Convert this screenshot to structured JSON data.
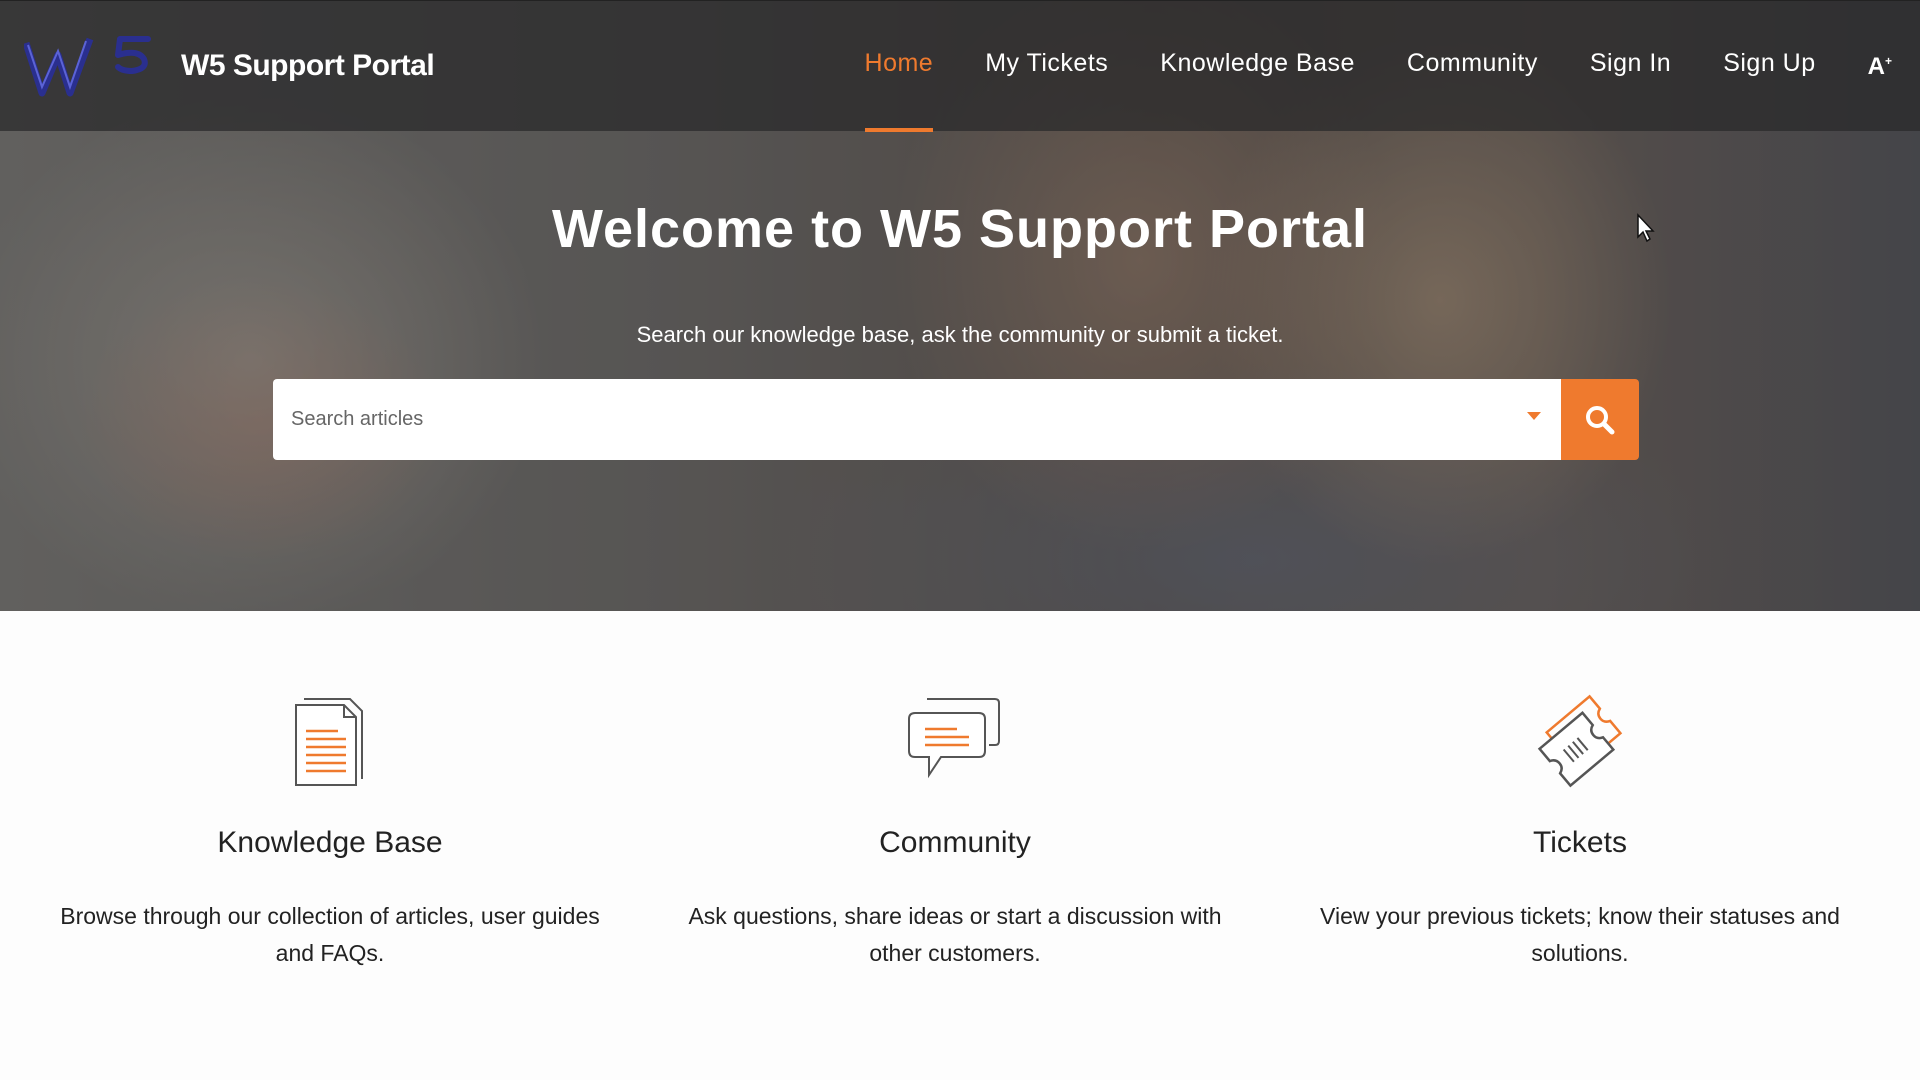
{
  "header": {
    "logo_text": "W5",
    "brand": "W5 Support Portal",
    "nav": [
      {
        "label": "Home",
        "active": true
      },
      {
        "label": "My Tickets"
      },
      {
        "label": "Knowledge Base"
      },
      {
        "label": "Community"
      },
      {
        "label": "Sign In"
      },
      {
        "label": "Sign Up"
      }
    ],
    "font_size_label": "A",
    "font_size_sup": "+"
  },
  "hero": {
    "title": "Welcome to W5 Support Portal",
    "subtitle": "Search our knowledge base, ask the community or submit a ticket.",
    "search_placeholder": "Search articles"
  },
  "features": [
    {
      "icon": "document-icon",
      "title": "Knowledge Base",
      "description": "Browse through our collection of articles, user guides and FAQs."
    },
    {
      "icon": "chat-icon",
      "title": "Community",
      "description": "Ask questions, share ideas or start a discussion with other customers."
    },
    {
      "icon": "ticket-icon",
      "title": "Tickets",
      "description": "View your previous tickets; know their statuses and solutions."
    }
  ],
  "colors": {
    "accent": "#ef7a2e",
    "navbar": "#2a2a2c",
    "logo_blue": "#2a2f8f"
  }
}
